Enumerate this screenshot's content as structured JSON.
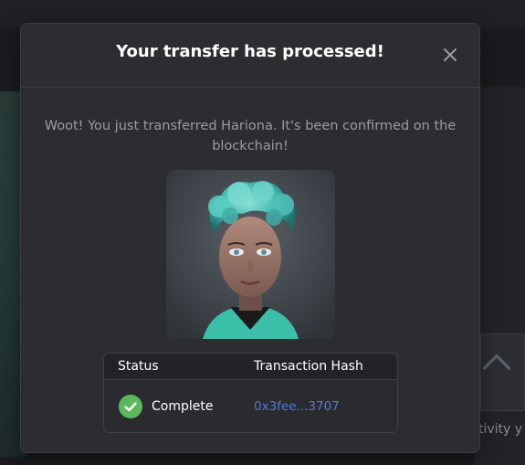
{
  "background": {
    "partial_text": "tivity y"
  },
  "modal": {
    "title": "Your transfer has processed!",
    "description": "Woot! You just transferred Hariona. It's been confirmed on the blockchain!",
    "close_icon": "close-icon",
    "image_alt": "Hariona"
  },
  "table": {
    "headers": {
      "status": "Status",
      "hash": "Transaction Hash"
    },
    "row": {
      "status_icon": "check-circle-icon",
      "status": "Complete",
      "hash": "0x3fee...3707"
    }
  },
  "colors": {
    "modal_bg": "#2c2d31",
    "success": "#5cb85c",
    "link": "#4f7bd8"
  }
}
